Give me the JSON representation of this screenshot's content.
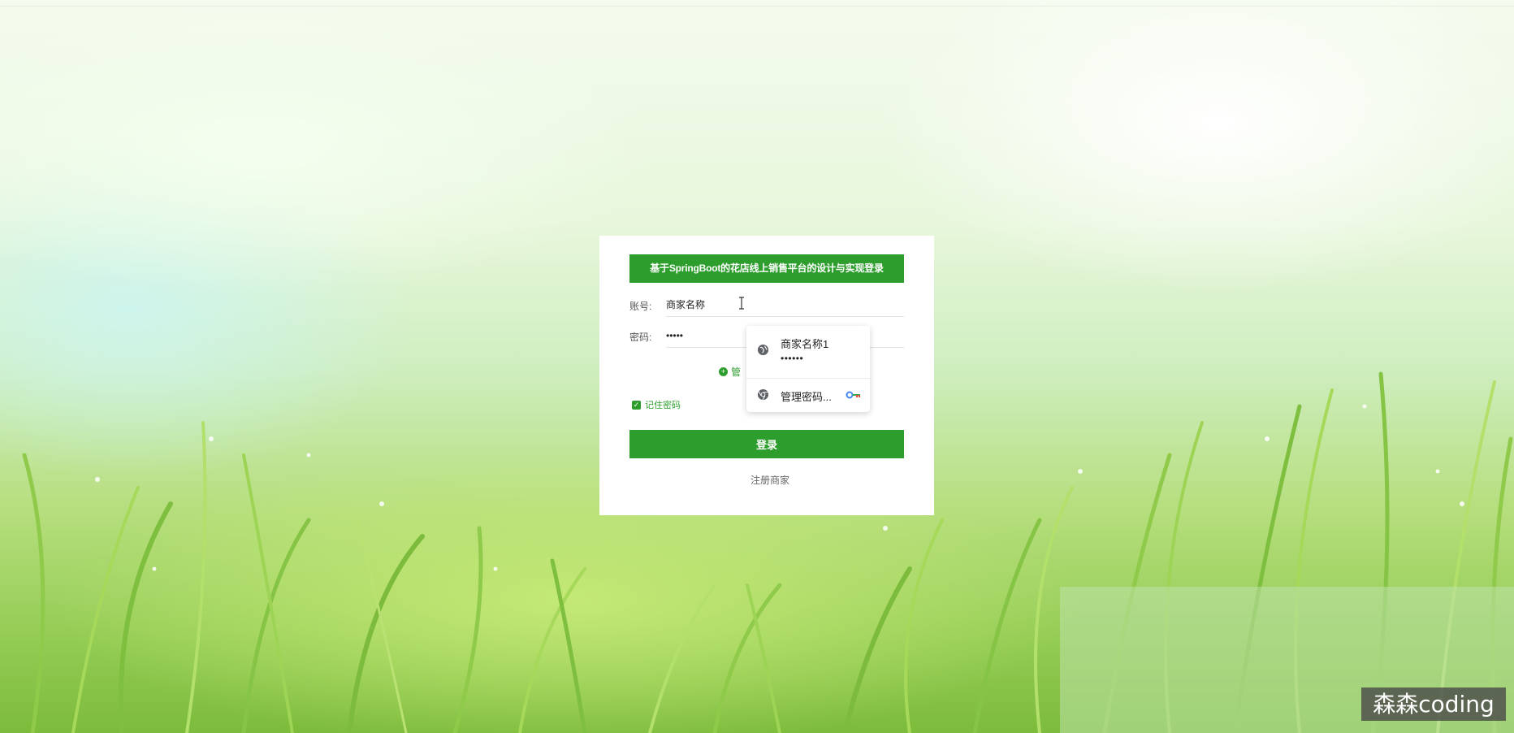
{
  "login": {
    "title": "基于SpringBoot的花店线上销售平台的设计与实现登录",
    "account_label": "账号:",
    "account_value": "商家名称",
    "password_label": "密码:",
    "password_value": "•••••",
    "manage_hint": "管",
    "remember_label": "记住密码",
    "login_button": "登录",
    "register_link": "注册商家"
  },
  "autofill": {
    "credential_user": "商家名称1",
    "credential_password": "••••••",
    "manage_label": "管理密码...",
    "site_icon": "globe-icon",
    "manage_icon": "chrome-icon",
    "key_icon": "key-icon"
  },
  "watermark": "森森coding",
  "colors": {
    "accent": "#2d9e2d",
    "card": "#ffffff"
  }
}
